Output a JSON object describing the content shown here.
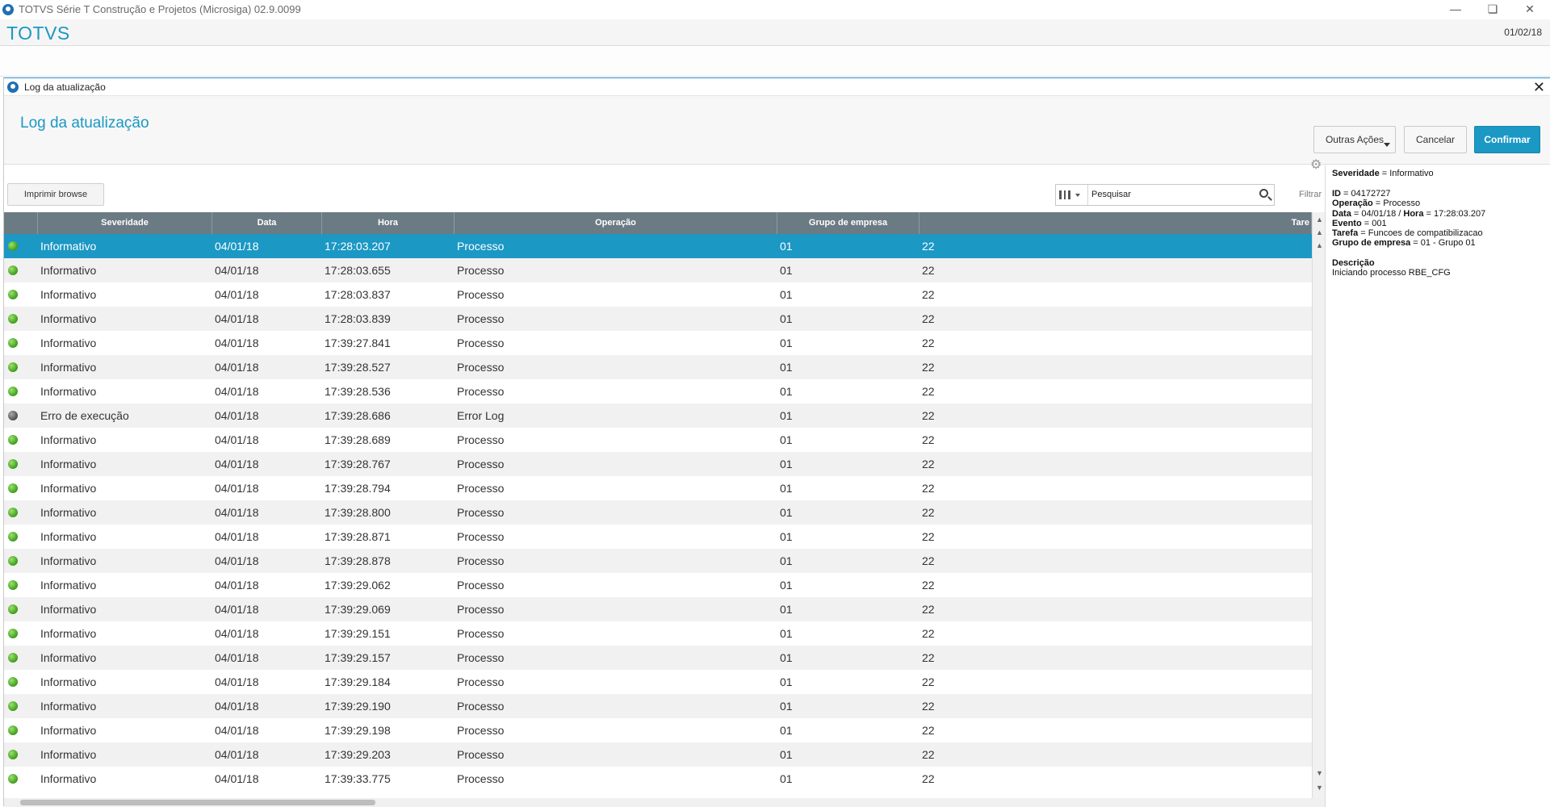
{
  "window": {
    "title": "TOTVS Série T Construção e Projetos (Microsiga) 02.9.0099",
    "controls": [
      "minimize",
      "restore",
      "close"
    ]
  },
  "app": {
    "brand": "TOTVS",
    "date": "01/02/18"
  },
  "dialog": {
    "title": "Log da atualização",
    "header_title": "Log da atualização",
    "buttons": {
      "outras_acoes": "Outras Ações",
      "cancelar": "Cancelar",
      "confirmar": "Confirmar"
    },
    "print_button": "Imprimir browse",
    "search": {
      "placeholder": "Pesquisar",
      "filter_label": "Filtrar"
    }
  },
  "grid": {
    "columns": [
      "Severidade",
      "Data",
      "Hora",
      "Operação",
      "Grupo de empresa",
      "Tare"
    ],
    "rows": [
      {
        "status": "green",
        "severidade": "Informativo",
        "data": "04/01/18",
        "hora": "17:28:03.207",
        "operacao": "Processo",
        "grupo": "01",
        "tarefa": "22",
        "selected": true
      },
      {
        "status": "green",
        "severidade": "Informativo",
        "data": "04/01/18",
        "hora": "17:28:03.655",
        "operacao": "Processo",
        "grupo": "01",
        "tarefa": "22"
      },
      {
        "status": "green",
        "severidade": "Informativo",
        "data": "04/01/18",
        "hora": "17:28:03.837",
        "operacao": "Processo",
        "grupo": "01",
        "tarefa": "22"
      },
      {
        "status": "green",
        "severidade": "Informativo",
        "data": "04/01/18",
        "hora": "17:28:03.839",
        "operacao": "Processo",
        "grupo": "01",
        "tarefa": "22"
      },
      {
        "status": "green",
        "severidade": "Informativo",
        "data": "04/01/18",
        "hora": "17:39:27.841",
        "operacao": "Processo",
        "grupo": "01",
        "tarefa": "22"
      },
      {
        "status": "green",
        "severidade": "Informativo",
        "data": "04/01/18",
        "hora": "17:39:28.527",
        "operacao": "Processo",
        "grupo": "01",
        "tarefa": "22"
      },
      {
        "status": "green",
        "severidade": "Informativo",
        "data": "04/01/18",
        "hora": "17:39:28.536",
        "operacao": "Processo",
        "grupo": "01",
        "tarefa": "22"
      },
      {
        "status": "gray",
        "severidade": "Erro de execução",
        "data": "04/01/18",
        "hora": "17:39:28.686",
        "operacao": "Error Log",
        "grupo": "01",
        "tarefa": "22"
      },
      {
        "status": "green",
        "severidade": "Informativo",
        "data": "04/01/18",
        "hora": "17:39:28.689",
        "operacao": "Processo",
        "grupo": "01",
        "tarefa": "22"
      },
      {
        "status": "green",
        "severidade": "Informativo",
        "data": "04/01/18",
        "hora": "17:39:28.767",
        "operacao": "Processo",
        "grupo": "01",
        "tarefa": "22"
      },
      {
        "status": "green",
        "severidade": "Informativo",
        "data": "04/01/18",
        "hora": "17:39:28.794",
        "operacao": "Processo",
        "grupo": "01",
        "tarefa": "22"
      },
      {
        "status": "green",
        "severidade": "Informativo",
        "data": "04/01/18",
        "hora": "17:39:28.800",
        "operacao": "Processo",
        "grupo": "01",
        "tarefa": "22"
      },
      {
        "status": "green",
        "severidade": "Informativo",
        "data": "04/01/18",
        "hora": "17:39:28.871",
        "operacao": "Processo",
        "grupo": "01",
        "tarefa": "22"
      },
      {
        "status": "green",
        "severidade": "Informativo",
        "data": "04/01/18",
        "hora": "17:39:28.878",
        "operacao": "Processo",
        "grupo": "01",
        "tarefa": "22"
      },
      {
        "status": "green",
        "severidade": "Informativo",
        "data": "04/01/18",
        "hora": "17:39:29.062",
        "operacao": "Processo",
        "grupo": "01",
        "tarefa": "22"
      },
      {
        "status": "green",
        "severidade": "Informativo",
        "data": "04/01/18",
        "hora": "17:39:29.069",
        "operacao": "Processo",
        "grupo": "01",
        "tarefa": "22"
      },
      {
        "status": "green",
        "severidade": "Informativo",
        "data": "04/01/18",
        "hora": "17:39:29.151",
        "operacao": "Processo",
        "grupo": "01",
        "tarefa": "22"
      },
      {
        "status": "green",
        "severidade": "Informativo",
        "data": "04/01/18",
        "hora": "17:39:29.157",
        "operacao": "Processo",
        "grupo": "01",
        "tarefa": "22"
      },
      {
        "status": "green",
        "severidade": "Informativo",
        "data": "04/01/18",
        "hora": "17:39:29.184",
        "operacao": "Processo",
        "grupo": "01",
        "tarefa": "22"
      },
      {
        "status": "green",
        "severidade": "Informativo",
        "data": "04/01/18",
        "hora": "17:39:29.190",
        "operacao": "Processo",
        "grupo": "01",
        "tarefa": "22"
      },
      {
        "status": "green",
        "severidade": "Informativo",
        "data": "04/01/18",
        "hora": "17:39:29.198",
        "operacao": "Processo",
        "grupo": "01",
        "tarefa": "22"
      },
      {
        "status": "green",
        "severidade": "Informativo",
        "data": "04/01/18",
        "hora": "17:39:29.203",
        "operacao": "Processo",
        "grupo": "01",
        "tarefa": "22"
      },
      {
        "status": "green",
        "severidade": "Informativo",
        "data": "04/01/18",
        "hora": "17:39:33.775",
        "operacao": "Processo",
        "grupo": "01",
        "tarefa": "22"
      }
    ]
  },
  "detail": {
    "severidade_label": "Severidade",
    "severidade_value": " = Informativo",
    "id_label": "ID",
    "id_value": " = 04172727",
    "operacao_label": "Operação",
    "operacao_value": " = Processo",
    "data_label": "Data",
    "data_value": " = 04/01/18 / ",
    "hora_label": "Hora",
    "hora_value": " = 17:28:03.207",
    "evento_label": "Evento",
    "evento_value": " = 001",
    "tarefa_label": "Tarefa",
    "tarefa_value": " = Funcoes de compatibilizacao",
    "grupo_label": "Grupo de empresa",
    "grupo_value": " = 01 - Grupo 01",
    "descricao_label": "Descrição",
    "descricao_value": "Iniciando processo RBE_CFG"
  },
  "colors": {
    "accent": "#1b98c4",
    "header_gray": "#6b7b84",
    "status_green": "#3e9b1d",
    "status_gray": "#4f4f4f"
  }
}
